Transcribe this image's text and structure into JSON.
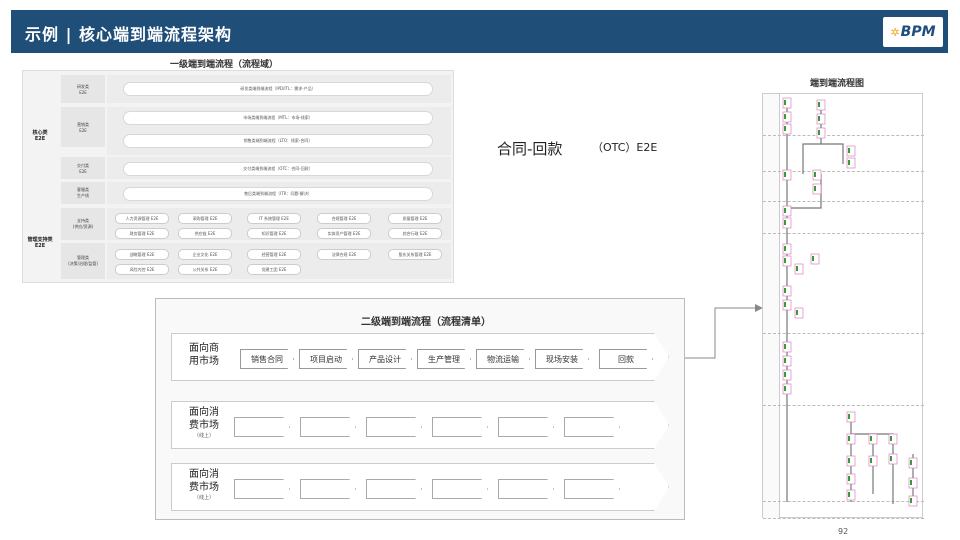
{
  "header": {
    "title": "示例 | 核心端到端流程架构",
    "logo": "BPM",
    "logo_color": "#1f4e79"
  },
  "level1": {
    "title": "一级端到端流程（流程域）",
    "core_label": "核心类\nE2E",
    "mgmt_label": "管理支持类\nE2E",
    "categories": [
      "研发类\nE2E",
      "营销类\nE2E",
      "交付类\nE2E",
      "客服类\n生产线",
      "支持类\n(供应/资源)",
      "管理类\n(决策/治理/监管)"
    ],
    "core_flows": [
      "研发类端到端流程（IPD/ITL：需求-产品）",
      "市场类端到端流程（MTL：市场-线索）",
      "销售类端到端流程（LTO：线索-合同）",
      "交付类端到端流程（OTC：合同-回款）",
      "售后类端到端流程（ITR：问题-解决）"
    ],
    "support_chips": [
      "人力资源管理 E2E",
      "采购管理 E2E",
      "IT 系统管理 E2E",
      "合规管理 E2E",
      "质量管理 E2E",
      "财务管理 E2E",
      "供应链 E2E",
      "知识管理 E2E",
      "实体资产管理 E2E",
      "综合行政 E2E"
    ],
    "mgmt_chips": [
      "战略管理 E2E",
      "企业文化 E2E",
      "经营管理 E2E",
      "法律合规 E2E",
      "股东关系管理 E2E",
      "风险内控 E2E",
      "公共关系 E2E",
      "党建工团 E2E"
    ]
  },
  "otc": {
    "main": "合同-回款",
    "sub": "（OTC）E2E"
  },
  "level2": {
    "title": "二级端到端流程（流程清单）",
    "rows": [
      {
        "label": "面向商\n用市场",
        "note": "",
        "steps": [
          "销售合同",
          "项目启动",
          "产品设计",
          "生产管理",
          "物流运输",
          "现场安装",
          "回款"
        ]
      },
      {
        "label": "面向消\n费市场",
        "note": "（线上）",
        "steps": [
          "",
          "",
          "",
          "",
          "",
          ""
        ]
      },
      {
        "label": "面向消\n费市场",
        "note": "（线上）",
        "steps": [
          "",
          "",
          "",
          "",
          "",
          ""
        ]
      }
    ]
  },
  "flow_map": {
    "title": "端到端流程图",
    "lanes": [
      "",
      "",
      "",
      "",
      "",
      "",
      "",
      ""
    ]
  },
  "page_number": "92"
}
